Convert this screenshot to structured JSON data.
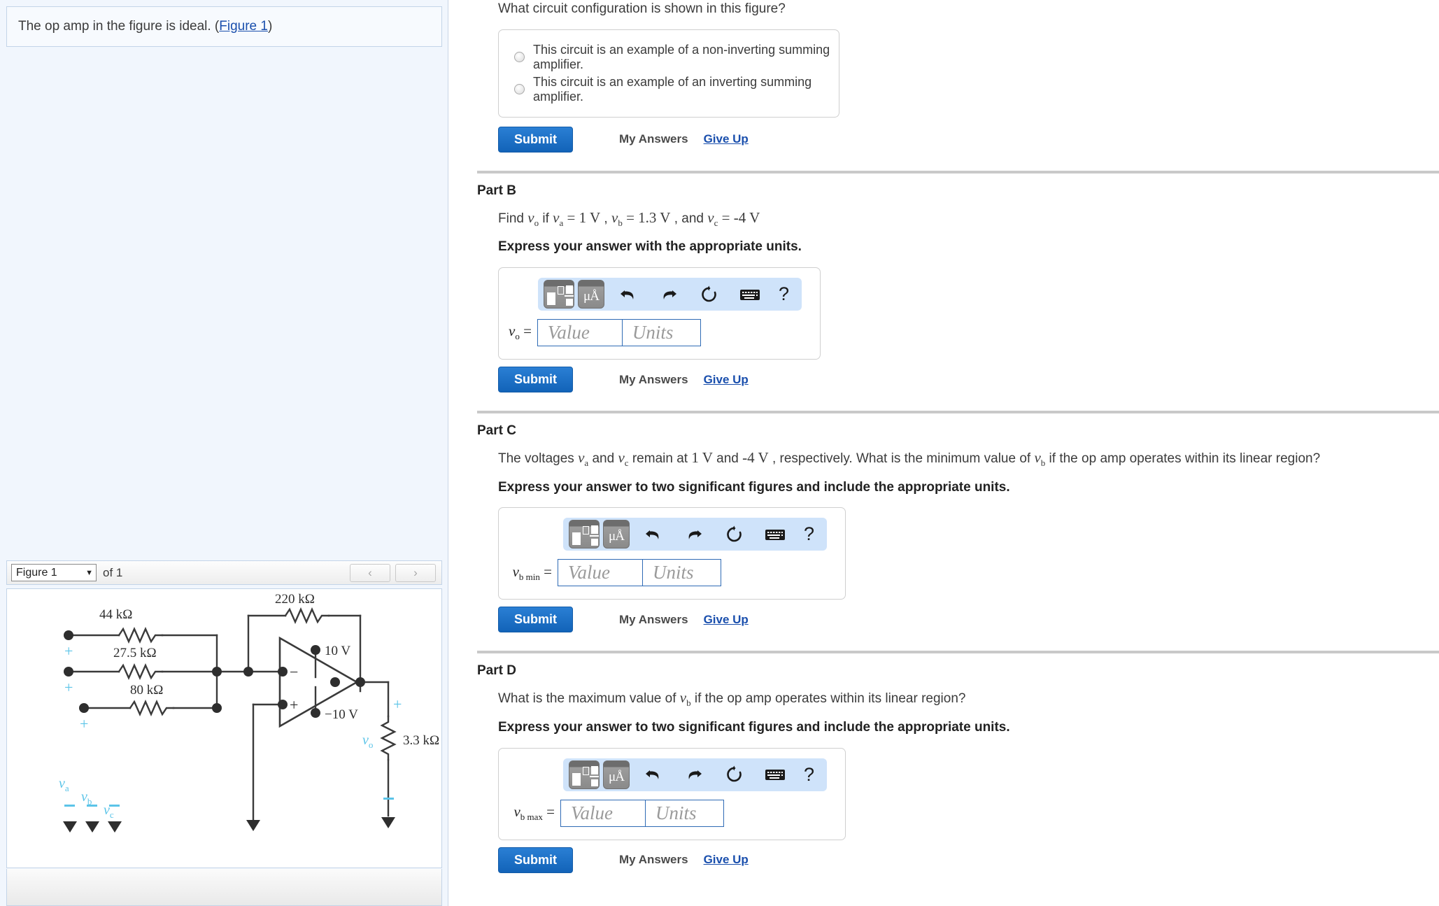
{
  "left_panel": {
    "intro_text_before": "The op amp in the figure is ideal. (",
    "intro_link": "Figure 1",
    "intro_text_after": ")",
    "figure_nav": {
      "selected_figure": "Figure 1",
      "of_label": "of 1",
      "prev_icon": "‹",
      "next_icon": "›",
      "caret": "▼"
    },
    "figure": {
      "title": "Figure 1",
      "labels": {
        "r1": "44 kΩ",
        "r2": "27.5 kΩ",
        "r3": "80 kΩ",
        "rf": "220 kΩ",
        "rl": "3.3 kΩ",
        "vpos": "10 V",
        "vneg": "−10 V",
        "va": "v",
        "va_sub": "a",
        "vb": "v",
        "vb_sub": "b",
        "vc": "v",
        "vc_sub": "c",
        "vo": "v",
        "vo_sub": "o",
        "plus": "+",
        "minus": "−",
        "opamp_inv": "−",
        "opamp_non": "+"
      }
    }
  },
  "parts": [
    {
      "id": "part-a",
      "title": "",
      "question": "What circuit configuration is shown in this figure?",
      "instruction": "",
      "type": "multiple-choice",
      "choices": [
        "This circuit is an example of a non-inverting summing amplifier.",
        "This circuit is an example of an inverting summing amplifier."
      ],
      "submit_label": "Submit",
      "my_answers_label": "My Answers",
      "give_up_label": "Give Up"
    },
    {
      "id": "part-b",
      "title": "Part B",
      "question_prefix": "Find ",
      "question_var": "v",
      "question_var_sub": "o",
      "question_mid": " if ",
      "terms": [
        {
          "var": "v",
          "sub": "a",
          "eq": " = ",
          "val": "1 V",
          "sep": " , "
        },
        {
          "var": "v",
          "sub": "b",
          "eq": " = ",
          "val": "1.3 V",
          "sep": " , and "
        },
        {
          "var": "v",
          "sub": "c",
          "eq": " = ",
          "val": "-4 V",
          "sep": ""
        }
      ],
      "instruction": "Express your answer with the appropriate units.",
      "type": "value-units",
      "answer_var": "v",
      "answer_var_sub": "o",
      "answer_eq": "=",
      "value_placeholder": "Value",
      "units_placeholder": "Units",
      "submit_label": "Submit",
      "my_answers_label": "My Answers",
      "give_up_label": "Give Up"
    },
    {
      "id": "part-c",
      "title": "Part C",
      "question_segments": [
        {
          "t": "The voltages ",
          "k": "text"
        },
        {
          "t": "v",
          "k": "mi",
          "sub": "a"
        },
        {
          "t": " and ",
          "k": "text"
        },
        {
          "t": "v",
          "k": "mi",
          "sub": "c"
        },
        {
          "t": " remain at ",
          "k": "text"
        },
        {
          "t": "1 V",
          "k": "mr"
        },
        {
          "t": " and ",
          "k": "text"
        },
        {
          "t": "-4 V",
          "k": "mr"
        },
        {
          "t": " , respectively. What is the minimum value of ",
          "k": "text"
        },
        {
          "t": "v",
          "k": "mi",
          "sub": "b"
        },
        {
          "t": " if the op amp operates within its linear region?",
          "k": "text"
        }
      ],
      "instruction": "Express your answer to two significant figures and include the appropriate units.",
      "type": "value-units",
      "answer_var": "v",
      "answer_var_sub": "b min",
      "answer_eq": "=",
      "value_placeholder": "Value",
      "units_placeholder": "Units",
      "submit_label": "Submit",
      "my_answers_label": "My Answers",
      "give_up_label": "Give Up"
    },
    {
      "id": "part-d",
      "title": "Part D",
      "question_segments": [
        {
          "t": "What is the maximum value of ",
          "k": "text"
        },
        {
          "t": "v",
          "k": "mi",
          "sub": "b"
        },
        {
          "t": " if the op amp operates within its linear region?",
          "k": "text"
        }
      ],
      "instruction": "Express your answer to two significant figures and include the appropriate units.",
      "type": "value-units",
      "answer_var": "v",
      "answer_var_sub": "b max",
      "answer_eq": "=",
      "value_placeholder": "Value",
      "units_placeholder": "Units",
      "submit_label": "Submit",
      "my_answers_label": "My Answers",
      "give_up_label": "Give Up"
    }
  ],
  "mathbar": {
    "template_icon": "math-template-icon",
    "units_icon": "micro-angstrom-units-icon",
    "units_icon_label": "μÅ",
    "undo_icon": "undo-icon",
    "redo_icon": "redo-icon",
    "reset_icon": "reset-icon",
    "keyboard_icon": "keyboard-icon",
    "help_icon": "?"
  },
  "colors": {
    "accent_blue": "#1263b8",
    "link_blue": "#1a4fad",
    "panel_bg": "#f1f6fd",
    "mathbar_bg": "#cfe3fa",
    "field_border": "#2f6bb5",
    "divider": "#c9c9c9",
    "circuit_cyan": "#5bc4e8"
  }
}
